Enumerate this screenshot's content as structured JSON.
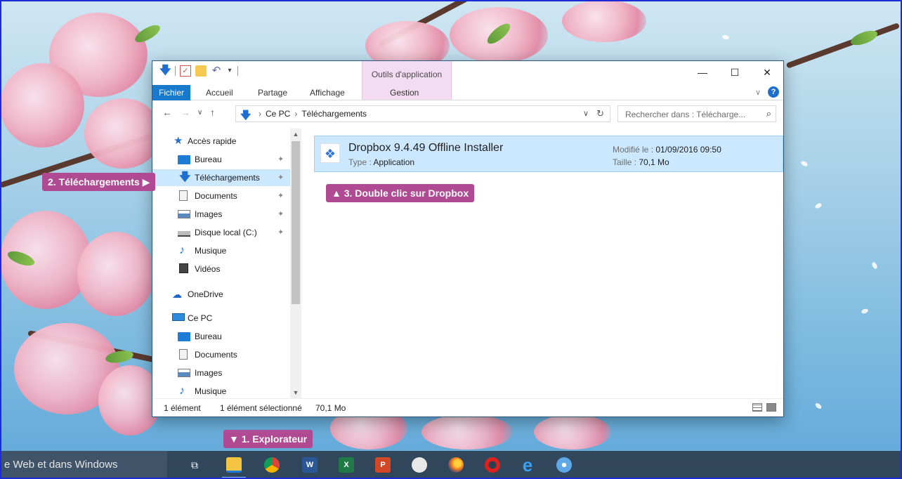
{
  "window": {
    "context_tab_title": "Outils d'application",
    "controls": {
      "minimize": "—",
      "maximize": "☐",
      "close": "✕"
    }
  },
  "ribbon": {
    "tabs": [
      "Fichier",
      "Accueil",
      "Partage",
      "Affichage",
      "Gestion"
    ]
  },
  "address": {
    "path": [
      "Ce PC",
      "Téléchargements"
    ],
    "search_placeholder": "Rechercher dans : Télécharge..."
  },
  "nav": {
    "items": [
      {
        "label": "Accès rapide",
        "icon": "star-icon",
        "pinned": false
      },
      {
        "label": "Bureau",
        "icon": "desktop-folder-icon",
        "pinned": true
      },
      {
        "label": "Téléchargements",
        "icon": "download-folder-icon",
        "pinned": true,
        "selected": true
      },
      {
        "label": "Documents",
        "icon": "documents-folder-icon",
        "pinned": true
      },
      {
        "label": "Images",
        "icon": "images-folder-icon",
        "pinned": true
      },
      {
        "label": "Disque local (C:)",
        "icon": "drive-icon",
        "pinned": true
      },
      {
        "label": "Musique",
        "icon": "music-folder-icon",
        "pinned": false
      },
      {
        "label": "Vidéos",
        "icon": "videos-folder-icon",
        "pinned": false
      },
      {
        "label": "OneDrive",
        "icon": "onedrive-icon",
        "pinned": false
      },
      {
        "label": "Ce PC",
        "icon": "this-pc-icon",
        "pinned": false
      },
      {
        "label": "Bureau",
        "icon": "desktop-folder-icon",
        "pinned": false
      },
      {
        "label": "Documents",
        "icon": "documents-folder-icon",
        "pinned": false
      },
      {
        "label": "Images",
        "icon": "images-folder-icon",
        "pinned": false
      },
      {
        "label": "Musique",
        "icon": "music-folder-icon",
        "pinned": false
      }
    ]
  },
  "file": {
    "name": "Dropbox 9.4.49 Offline Installer",
    "type_label": "Type : ",
    "type_value": "Application",
    "modified_label": "Modifié le : ",
    "modified_value": "01/09/2016 09:50",
    "size_label": "Taille : ",
    "size_value": "70,1 Mo"
  },
  "status": {
    "count": "1 élément",
    "selected": "1 élément sélectionné",
    "size": "70,1 Mo"
  },
  "callouts": {
    "step1": "▼ 1. Explorateur",
    "step2": "2. Téléchargements ▶",
    "step3": "▲ 3. Double clic sur Dropbox"
  },
  "taskbar": {
    "search_text": "e Web et dans Windows",
    "word_label": "W",
    "excel_label": "X",
    "ppt_label": "P"
  },
  "colors": {
    "accent": "#1979ca",
    "callout": "#b04a92",
    "selection": "#cce8ff"
  }
}
